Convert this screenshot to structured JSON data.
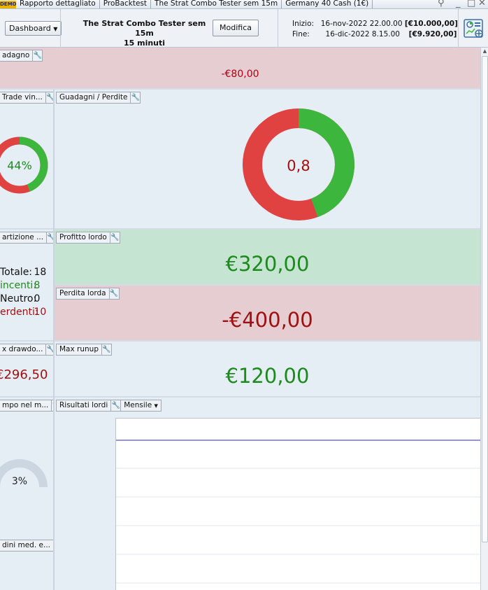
{
  "titlebar": {
    "demo_badge": "DEMO",
    "tabs": [
      "Rapporto dettagliato",
      "ProBacktest",
      "The Strat Combo Tester sem 15m",
      "Germany 40 Cash (1€)"
    ],
    "controls": [
      "_",
      "□",
      "✕"
    ]
  },
  "header": {
    "dashboard_label": "Dashboard",
    "strategy_title_line1": "The Strat Combo Tester sem 15m",
    "strategy_title_line2": "15 minuti",
    "modifica_label": "Modifica",
    "inizio_label": "Inizio:",
    "inizio_date": "16-nov-2022 22.00.00",
    "inizio_capital": "[€10.000,00]",
    "fine_label": "Fine:",
    "fine_date": "16-dic-2022 8.15.00",
    "fine_capital": "[€9.920,00]"
  },
  "widgets": {
    "guadagno": {
      "label": "adagno",
      "value": "-€80,00"
    },
    "trade_vincenti": {
      "label": "Trade vin...",
      "percent": 44,
      "percent_text": "44%"
    },
    "guadagni_perdite": {
      "label": "Guadagni / Perdite",
      "ratio_text": "0,8",
      "gain_fraction": 0.444
    },
    "ripartizione": {
      "label": "artizione ...",
      "rows": [
        {
          "label": "Totale:",
          "value": "18",
          "tone": "neutral"
        },
        {
          "label": "incenti:",
          "value": "8",
          "tone": "green"
        },
        {
          "label": "Neutro:",
          "value": "0",
          "tone": "neutral"
        },
        {
          "label": "erdenti:",
          "value": "10",
          "tone": "red"
        }
      ]
    },
    "profitto_lordo": {
      "label": "Profitto lordo",
      "value": "€320,00"
    },
    "perdita_lorda": {
      "label": "Perdita lorda",
      "value": "-€400,00"
    },
    "max_drawdown": {
      "label": "x drawdo...",
      "value": "€296,50"
    },
    "max_runup": {
      "label": "Max runup",
      "value": "€120,00"
    },
    "tempo_mercato": {
      "label": "mpo nel m...",
      "percent": 3,
      "percent_text": "3%"
    },
    "risultati_lordi": {
      "label": "Risultati lordi",
      "period": "Mensile"
    },
    "ordini_medi": {
      "label": "dini med. e..."
    }
  },
  "colors": {
    "gain": "#3db63d",
    "loss": "#e04141",
    "gauge_empty": "#d8e2eb",
    "gauge_fill": "#c7d3df",
    "chart_line": "#2a2f9a"
  }
}
